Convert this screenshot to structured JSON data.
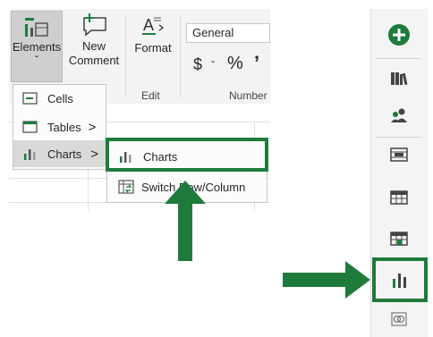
{
  "ribbon": {
    "elements_label": "Elements",
    "elements_caret": "ˇ",
    "new_comment_line1": "New",
    "new_comment_line2": "Comment",
    "format_label": "Format",
    "edit_group_label": "Edit",
    "number_format_value": "General",
    "currency_symbol": "$",
    "currency_caret": "ˇ",
    "percent_symbol": "%",
    "comma_symbol": "’",
    "number_group_label": "Number"
  },
  "elements_menu": {
    "items": [
      {
        "label": "Cells",
        "has_submenu": false
      },
      {
        "label": "Tables",
        "has_submenu": true
      },
      {
        "label": "Charts",
        "has_submenu": true
      }
    ],
    "submenu_arrow": ">"
  },
  "charts_submenu": {
    "items": [
      {
        "label": "Charts"
      },
      {
        "label": "Switch Row/Column"
      }
    ]
  },
  "side_panel": {
    "icons": [
      "add-circle-icon",
      "books-icon",
      "people-icon",
      "film-icon",
      "table-icon",
      "table-edit-icon",
      "bar-chart-icon",
      "link-icon"
    ]
  },
  "colors": {
    "highlight": "#1e7b3c",
    "accent_green": "#1e7b3c",
    "ribbon_bg": "#f3f3f3"
  }
}
